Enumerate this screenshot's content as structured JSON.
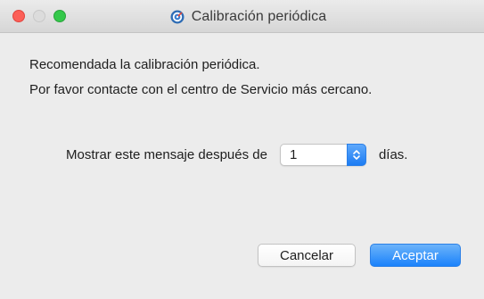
{
  "window": {
    "title": "Calibración periódica",
    "app_icon": "calibration-app-icon"
  },
  "message": {
    "line1": "Recomendada la calibración periódica.",
    "line2": "Por favor contacte con el centro de Servicio más cercano."
  },
  "reminder": {
    "label": "Mostrar este mensaje después de",
    "value": "1",
    "unit": "días."
  },
  "buttons": {
    "cancel": "Cancelar",
    "accept": "Aceptar"
  },
  "colors": {
    "accent": "#1a82fb",
    "close": "#fc5f57",
    "maximize": "#34c84a"
  }
}
